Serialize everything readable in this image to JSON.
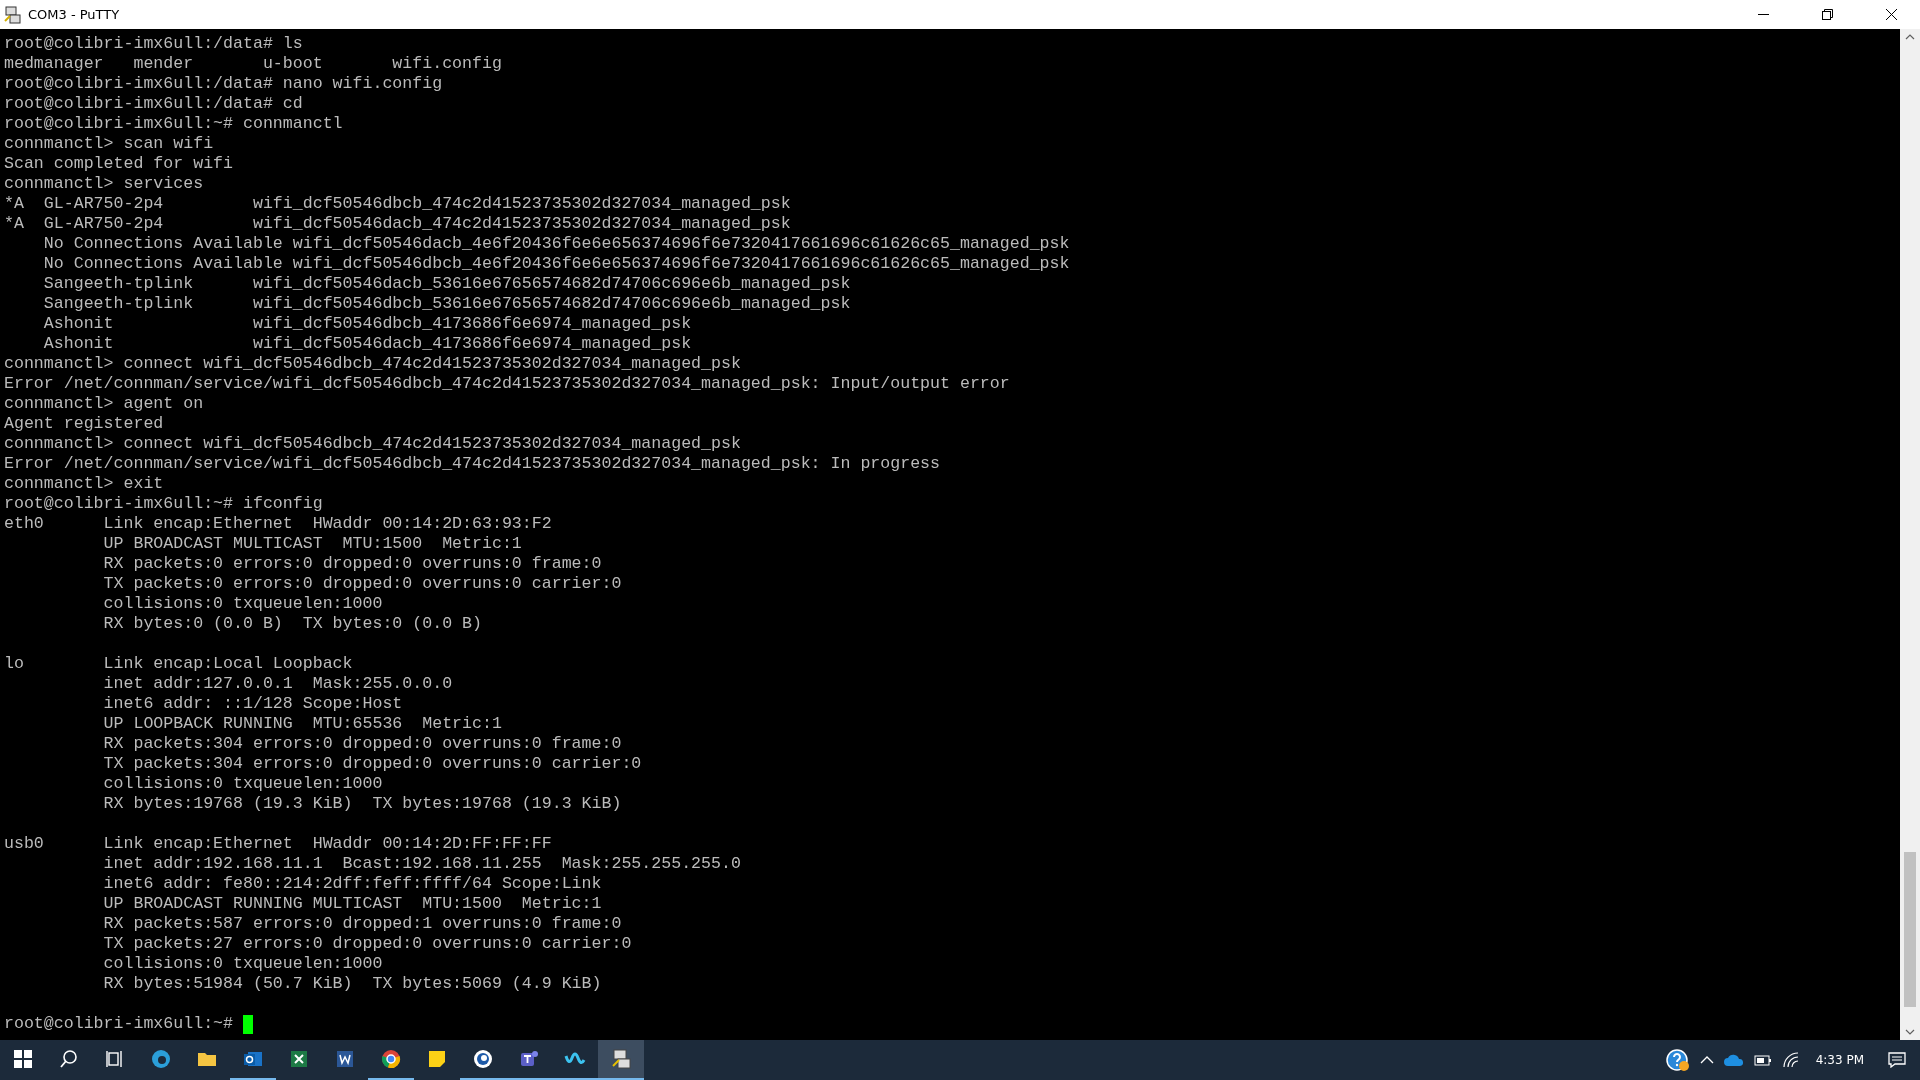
{
  "window": {
    "title": "COM3 - PuTTY"
  },
  "terminal": {
    "blocks": [
      {
        "lines": [
          "root@colibri-imx6ull:/data# ls",
          "medmanager   mender       u-boot       wifi.config",
          "root@colibri-imx6ull:/data# nano wifi.config",
          "root@colibri-imx6ull:/data# cd",
          "root@colibri-imx6ull:~# connmanctl",
          "connmanctl> scan wifi",
          "Scan completed for wifi",
          "connmanctl> services",
          "*A  GL-AR750-2p4         wifi_dcf50546dbcb_474c2d41523735302d327034_managed_psk",
          "*A  GL-AR750-2p4         wifi_dcf50546dacb_474c2d41523735302d327034_managed_psk",
          "    No Connections Available wifi_dcf50546dacb_4e6f20436f6e6e656374696f6e7320417661696c61626c65_managed_psk",
          "    No Connections Available wifi_dcf50546dbcb_4e6f20436f6e6e656374696f6e7320417661696c61626c65_managed_psk",
          "    Sangeeth-tplink      wifi_dcf50546dacb_53616e67656574682d74706c696e6b_managed_psk",
          "    Sangeeth-tplink      wifi_dcf50546dbcb_53616e67656574682d74706c696e6b_managed_psk",
          "    Ashonit              wifi_dcf50546dbcb_4173686f6e6974_managed_psk",
          "    Ashonit              wifi_dcf50546dacb_4173686f6e6974_managed_psk",
          "connmanctl> connect wifi_dcf50546dbcb_474c2d41523735302d327034_managed_psk",
          "Error /net/connman/service/wifi_dcf50546dbcb_474c2d41523735302d327034_managed_psk: Input/output error",
          "connmanctl> agent on",
          "Agent registered",
          "connmanctl> connect wifi_dcf50546dbcb_474c2d41523735302d327034_managed_psk",
          "Error /net/connman/service/wifi_dcf50546dbcb_474c2d41523735302d327034_managed_psk: In progress",
          "connmanctl> exit",
          "root@colibri-imx6ull:~# ifconfig",
          "eth0      Link encap:Ethernet  HWaddr 00:14:2D:63:93:F2",
          "          UP BROADCAST MULTICAST  MTU:1500  Metric:1",
          "          RX packets:0 errors:0 dropped:0 overruns:0 frame:0",
          "          TX packets:0 errors:0 dropped:0 overruns:0 carrier:0",
          "          collisions:0 txqueuelen:1000",
          "          RX bytes:0 (0.0 B)  TX bytes:0 (0.0 B)"
        ]
      },
      {
        "lines": [
          "lo        Link encap:Local Loopback",
          "          inet addr:127.0.0.1  Mask:255.0.0.0",
          "          inet6 addr: ::1/128 Scope:Host",
          "          UP LOOPBACK RUNNING  MTU:65536  Metric:1",
          "          RX packets:304 errors:0 dropped:0 overruns:0 frame:0",
          "          TX packets:304 errors:0 dropped:0 overruns:0 carrier:0",
          "          collisions:0 txqueuelen:1000",
          "          RX bytes:19768 (19.3 KiB)  TX bytes:19768 (19.3 KiB)"
        ]
      },
      {
        "lines": [
          "usb0      Link encap:Ethernet  HWaddr 00:14:2D:FF:FF:FF",
          "          inet addr:192.168.11.1  Bcast:192.168.11.255  Mask:255.255.255.0",
          "          inet6 addr: fe80::214:2dff:feff:ffff/64 Scope:Link",
          "          UP BROADCAST RUNNING MULTICAST  MTU:1500  Metric:1",
          "          RX packets:587 errors:0 dropped:1 overruns:0 frame:0",
          "          TX packets:27 errors:0 dropped:0 overruns:0 carrier:0",
          "          collisions:0 txqueuelen:1000",
          "          RX bytes:51984 (50.7 KiB)  TX bytes:5069 (4.9 KiB)"
        ]
      }
    ],
    "prompt": "root@colibri-imx6ull:~#"
  },
  "taskbar": {
    "apps": [
      {
        "kind": "start",
        "running": false,
        "selected": false
      },
      {
        "kind": "search",
        "running": false,
        "selected": false
      },
      {
        "kind": "taskview",
        "running": false,
        "selected": false
      },
      {
        "kind": "browser",
        "running": false,
        "selected": false
      },
      {
        "kind": "folder",
        "running": false,
        "selected": false
      },
      {
        "kind": "mail",
        "running": true,
        "selected": false
      },
      {
        "kind": "sheet",
        "running": false,
        "selected": false
      },
      {
        "kind": "doc",
        "running": false,
        "selected": false
      },
      {
        "kind": "chrome",
        "running": true,
        "selected": false
      },
      {
        "kind": "note",
        "running": false,
        "selected": false
      },
      {
        "kind": "chat",
        "running": true,
        "selected": false
      },
      {
        "kind": "team",
        "running": true,
        "selected": false
      },
      {
        "kind": "meet",
        "running": true,
        "selected": false
      },
      {
        "kind": "terminal",
        "running": true,
        "selected": true
      }
    ],
    "clock": "4:33 PM"
  }
}
